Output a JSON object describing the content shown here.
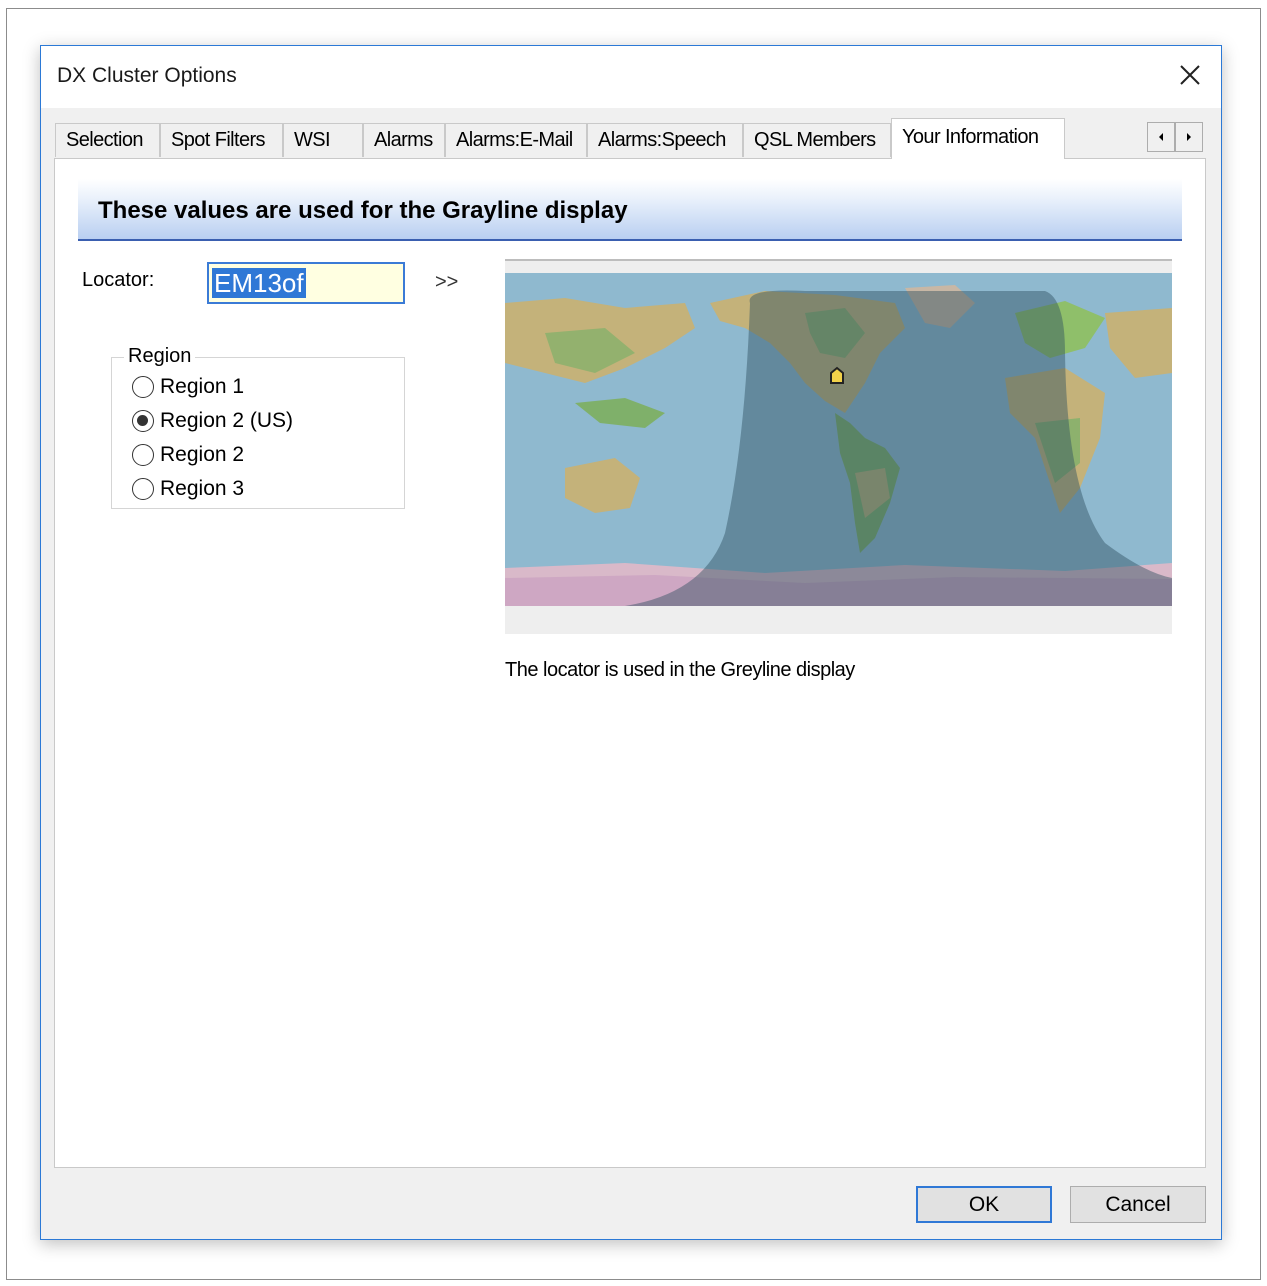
{
  "window": {
    "title": "DX Cluster Options"
  },
  "tabs": [
    {
      "label": "Selection"
    },
    {
      "label": "Spot Filters"
    },
    {
      "label": "WSI"
    },
    {
      "label": "Alarms"
    },
    {
      "label": "Alarms:E-Mail"
    },
    {
      "label": "Alarms:Speech"
    },
    {
      "label": "QSL Members"
    },
    {
      "label": "Your Information",
      "active": true
    }
  ],
  "panel": {
    "banner": "These values are used for the Grayline display",
    "locator_label": "Locator:",
    "locator_value": "EM13of",
    "arrow_button": ">>",
    "region": {
      "legend": "Region",
      "options": [
        {
          "label": "Region 1",
          "checked": false
        },
        {
          "label": "Region 2 (US)",
          "checked": true
        },
        {
          "label": "Region 2",
          "checked": false
        },
        {
          "label": "Region 3",
          "checked": false
        }
      ]
    },
    "map_caption": "The locator is used in the Greyline display"
  },
  "buttons": {
    "ok": "OK",
    "cancel": "Cancel"
  },
  "colors": {
    "accent": "#2f78d6",
    "input_bg": "#ffffe1",
    "ocean": "#8fb9cf",
    "night": "#5f7f8c",
    "land": "#c4b27a"
  }
}
